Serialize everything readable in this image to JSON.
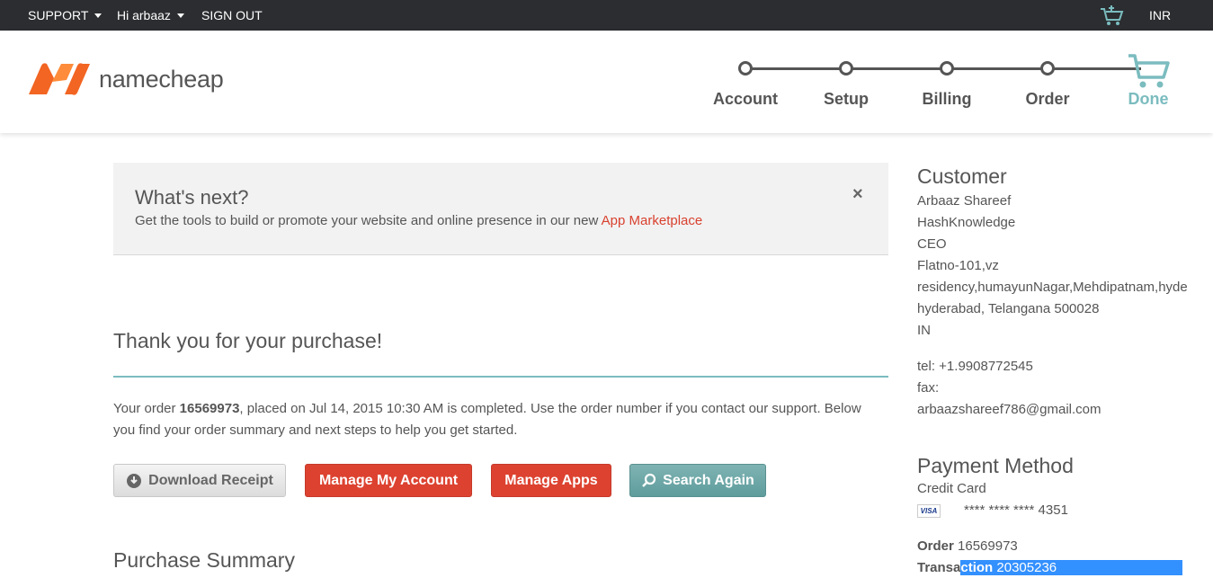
{
  "topbar": {
    "support": "SUPPORT",
    "greeting": "Hi arbaaz",
    "signout": "SIGN OUT",
    "currency": "INR"
  },
  "header": {
    "logo_text": "namecheap",
    "steps": [
      "Account",
      "Setup",
      "Billing",
      "Order",
      "Done"
    ]
  },
  "whats_next": {
    "title": "What's next?",
    "text": "Get the tools to build or promote your website and online presence in our new ",
    "link": "App Marketplace",
    "close": "×"
  },
  "thanks": {
    "title": "Thank you for your purchase!",
    "order_prefix": "Your order ",
    "order_number": "16569973",
    "order_suffix": ", placed on Jul 14, 2015 10:30 AM is completed. Use the order number if you contact our support. Below you find your order summary and next steps to help you get started."
  },
  "buttons": {
    "download": "Download Receipt",
    "manage_account": "Manage My Account",
    "manage_apps": "Manage Apps",
    "search_again": "Search Again"
  },
  "purchase_summary": "Purchase Summary",
  "customer": {
    "title": "Customer",
    "lines": [
      "Arbaaz Shareef",
      "HashKnowledge",
      "CEO",
      "Flatno-101,vz",
      "residency,humayunNagar,Mehdipatnam,hyde",
      "hyderabad, Telangana 500028",
      "IN"
    ],
    "tel": "tel: +1.9908772545",
    "fax": "fax:",
    "email": "arbaazshareef786@gmail.com"
  },
  "payment": {
    "title": "Payment Method",
    "method": "Credit Card",
    "card_brand": "VISA",
    "card_number": "**** **** **** 4351",
    "order_label": "Order",
    "order_value": "16569973",
    "transaction_label_a": "Transa",
    "transaction_label_b": "ction",
    "transaction_value": "20305236"
  },
  "colors": {
    "accent_red": "#dd4230",
    "accent_teal": "#7bbcbf",
    "topbar": "#2b2d30"
  }
}
